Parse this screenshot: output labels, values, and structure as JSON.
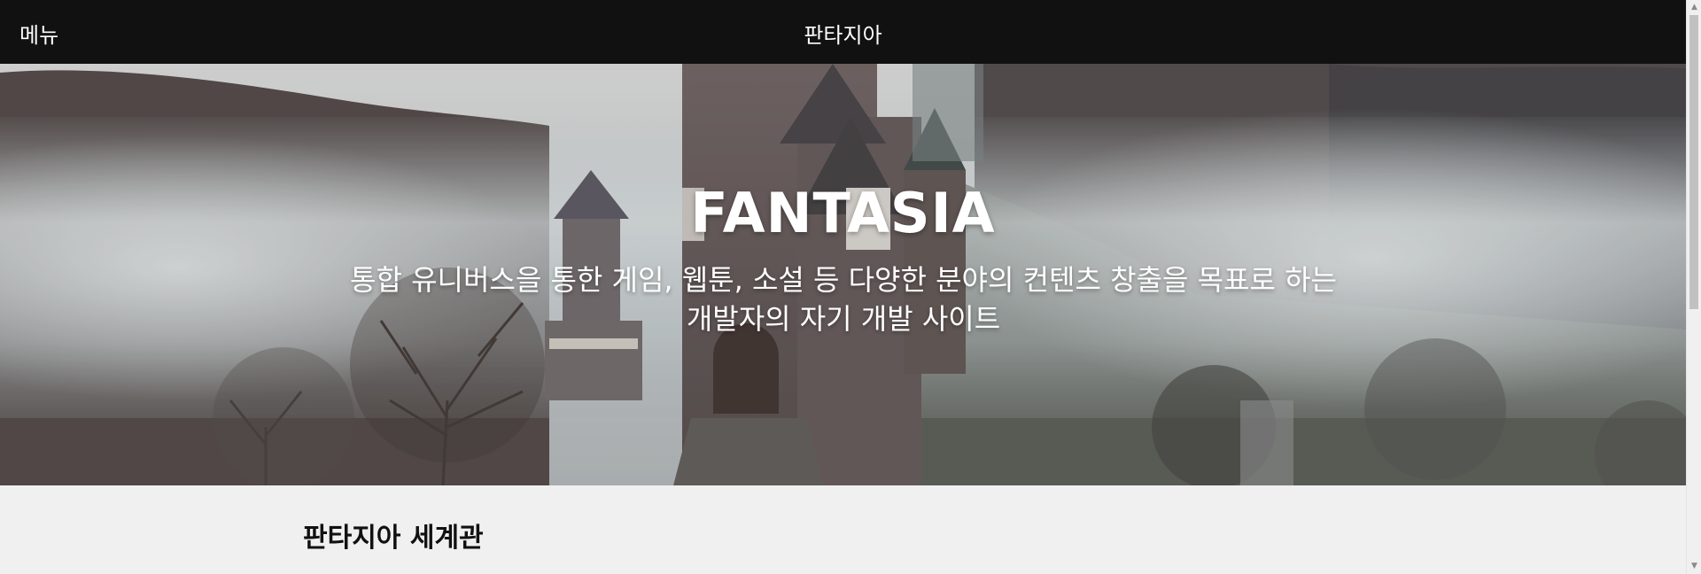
{
  "topbar": {
    "menu_label": "메뉴",
    "title": "판타지아"
  },
  "hero": {
    "title": "FANTASIA",
    "subtitle": "통합 유니버스을 통한 게임, 웹툰, 소설 등 다양한 분야의 컨텐츠 창출을 목표로 하는 개발자의 자기 개발 사이트",
    "image": "misty-castle-photo"
  },
  "section": {
    "heading": "판타지아 세계관"
  },
  "colors": {
    "topbar_bg": "#111111",
    "page_bg": "#f0f0f0",
    "hero_text": "#ffffff"
  }
}
